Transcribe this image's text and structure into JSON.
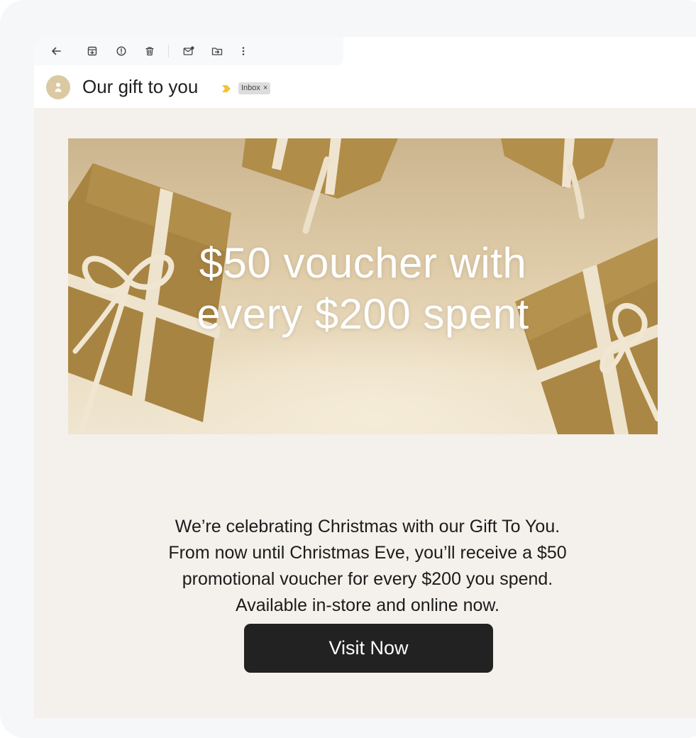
{
  "toolbar": {
    "icons": [
      "back-arrow-icon",
      "archive-icon",
      "report-spam-icon",
      "delete-icon",
      "mark-unread-icon",
      "move-to-icon",
      "more-options-icon"
    ]
  },
  "email": {
    "subject": "Our gift to you",
    "label": "Inbox",
    "label_remove": "×"
  },
  "hero": {
    "line1": "$50 voucher with",
    "line2": "every $200 spent"
  },
  "body": {
    "lines": [
      "We’re celebrating Christmas with our Gift To You.",
      "From now until Christmas Eve, you’ll receive a $50",
      "promotional voucher for every $200 you spend.",
      "Available in-store and online now."
    ]
  },
  "cta": {
    "label": "Visit Now"
  },
  "colors": {
    "importance_marker": "#f4c430",
    "cta_background": "#222222",
    "email_background": "#f4f1ec",
    "avatar": "#dac9a3"
  }
}
